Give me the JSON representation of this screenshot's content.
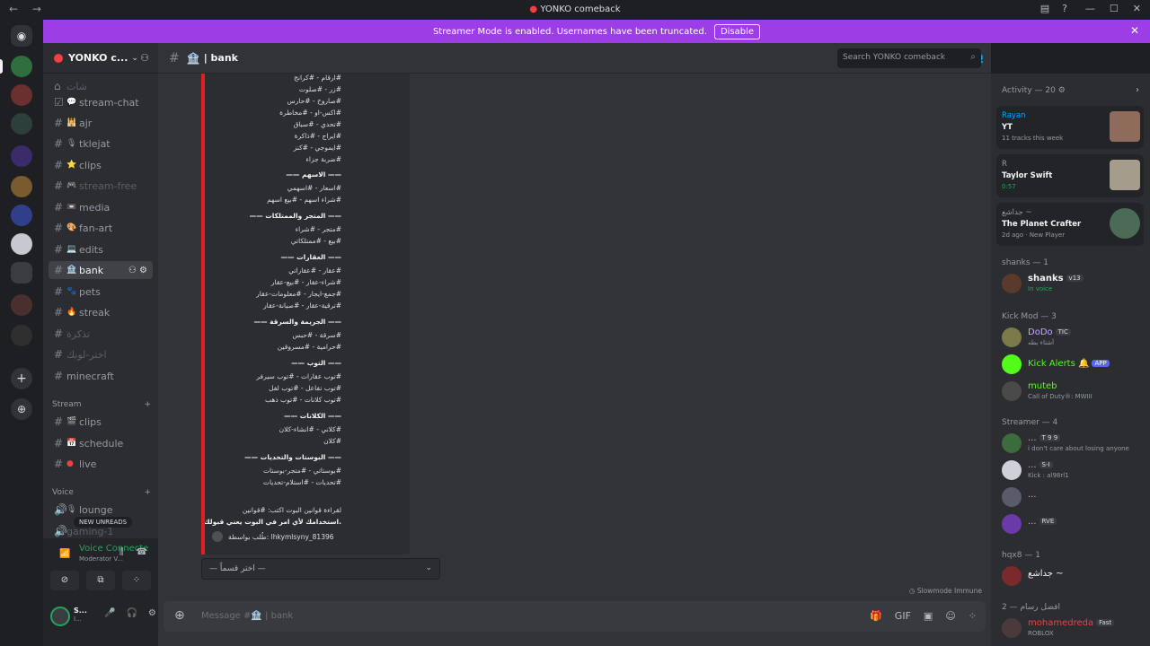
{
  "window": {
    "title": "YONKO comeback",
    "back_forward": "← →"
  },
  "banner": {
    "text": "Streamer Mode is enabled. Usernames have been truncated.",
    "button": "Disable"
  },
  "guild": {
    "name": "YONKO c..."
  },
  "channels": [
    {
      "name": "شات",
      "muted": true
    },
    {
      "name": "stream-chat"
    },
    {
      "name": "ajr"
    },
    {
      "name": "tklejat"
    },
    {
      "name": "clips"
    },
    {
      "name": "stream-free",
      "muted": true
    },
    {
      "name": "media"
    },
    {
      "name": "fan-art"
    },
    {
      "name": "edits"
    },
    {
      "name": "bank",
      "selected": true
    },
    {
      "name": "pets"
    },
    {
      "name": "streak"
    },
    {
      "name": "تذكرة",
      "muted": true
    },
    {
      "name": "اختر-لونك",
      "muted": true
    },
    {
      "name": "minecraft"
    }
  ],
  "stream_category": {
    "label": "Stream",
    "channels": [
      "clips",
      "schedule",
      "live"
    ]
  },
  "voice_category": {
    "label": "Voice",
    "channels": [
      "lounge",
      "gaming-1"
    ],
    "new_unreads": "NEW UNREADS"
  },
  "voice_status": {
    "title": "Voice Connecte",
    "subtitle": "Moderator V..."
  },
  "user": {
    "name": "S...",
    "status": "I..."
  },
  "channel_header": {
    "name": "| bank"
  },
  "search": {
    "placeholder": "Search YONKO comeback"
  },
  "embed": {
    "lines": [
      "#ارقام - #كرانج",
      "#زر - #صلوت",
      "#صاروخ - #حارس",
      "#اكس-او - #مخاطرة",
      "#تحدي - #سباق",
      "#ايراج - #ذاكرة",
      "#ايموجي - #كنز",
      "#ضربة جزاء",
      "—— الاسهم ——",
      "#اسعار - #اسهمي",
      "#شراء اسهم - #بيع اسهم",
      "—— المتجر والممتلكات ——",
      "#متجر - #شراء",
      "#بيع - #ممتلكاتي",
      "—— العقارات ——",
      "#عقار - #عقاراتي",
      "#شراء-عقار - #بيع-عقار",
      "#جمع-ايجار - #معلومات-عقار",
      "#ترقية-عقار - #صيانة-عقار",
      "—— الجريمة والسرقة ——",
      "#سرقة - #حبس",
      "#حرامية - #مسروقين",
      "—— التوب ——",
      "#توب عقارات - #توب سيرفر",
      "#توب تفاعل - #توب لفل",
      "#توب كلانات - #توب ذهب",
      "—— الكلانات ——",
      "#كلاني - #انشاء-كلان",
      "#كلان",
      "—— البوستات والتحديات ——",
      "#بوستاتي - #متجر-بوستات",
      "#تحديات - #استلام-تحديات",
      "لقراءة قوانين البوت اكتب: #قوانين",
      "استخدامك لأي امر في البوت يعني قبولك للقوانين."
    ],
    "footer": "طُلب بواسطة: lhkymlsyny_81396"
  },
  "select_menu": {
    "placeholder": "— اختر قسماً —"
  },
  "slowmode": "Slowmode Immune",
  "composer": {
    "placeholder": "Message #🏦 | bank"
  },
  "activity": {
    "header": "Activity — 20",
    "cards": [
      {
        "line1": "Rayan",
        "line2": "YT",
        "line3": "11 tracks this week",
        "color": "#8e6b5a"
      },
      {
        "line1": "R",
        "line2": "Taylor Swift",
        "line3": "0:57",
        "green": true,
        "color": "#a59c8c"
      },
      {
        "line1": "جداشع ~",
        "line2": "The Planet Crafter",
        "line3": "2d ago · New Player",
        "color": "#4c6b56"
      }
    ]
  },
  "member_groups": [
    {
      "label": "shanks — 1",
      "members": [
        {
          "name": "shanks",
          "tag": "v13",
          "status": "In voice",
          "color": "#f2f3f5"
        }
      ]
    },
    {
      "label": "Kick Mod — 3",
      "members": [
        {
          "name": "DoDo",
          "tag": "TIC",
          "status": "أشتاء بطه",
          "color": "#c9a7ff"
        },
        {
          "name": "Kick Alerts",
          "tag": "APP",
          "status": "",
          "color": "#53fc18"
        },
        {
          "name": "muteb",
          "tag": "",
          "status": "Call of Duty®: MWIII",
          "color": "#53fc18"
        }
      ]
    },
    {
      "label": "Streamer — 4",
      "members": [
        {
          "name": "...",
          "tag": "T 9 9",
          "status": "i don't care about losing anyone",
          "color": "#e8a3a3"
        },
        {
          "name": "...",
          "tag": "S-I",
          "status": "Kick : al98rl1",
          "color": "#e8a3a3"
        },
        {
          "name": "...",
          "tag": "",
          "status": "",
          "color": "#e8a3a3"
        },
        {
          "name": "...",
          "tag": "RVE",
          "status": "",
          "color": "#e8a3a3"
        }
      ]
    },
    {
      "label": "hqx8 — 1",
      "members": [
        {
          "name": "جداشع ~",
          "tag": "",
          "status": "",
          "color": "#f2f3f5"
        }
      ]
    },
    {
      "label": "افضل رسام — 2",
      "members": [
        {
          "name": "mohamedreda",
          "tag": "Fast",
          "status": "ROBLOX",
          "color": "#f23f42"
        }
      ]
    }
  ]
}
